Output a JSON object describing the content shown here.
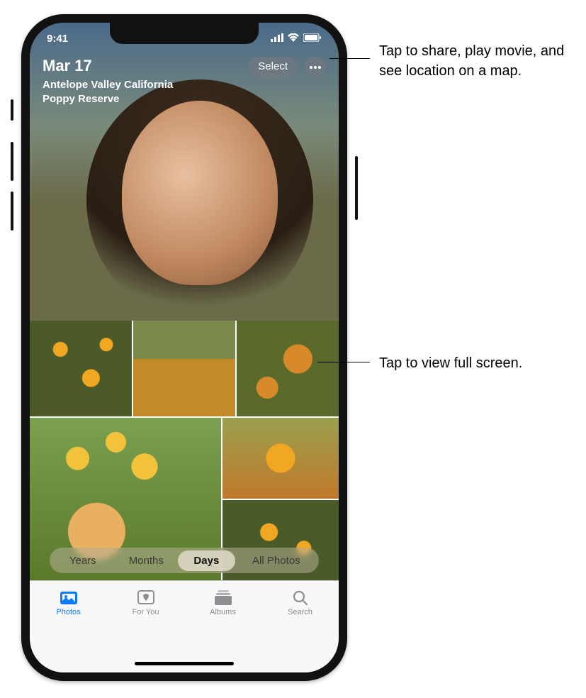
{
  "status": {
    "time": "9:41"
  },
  "hero": {
    "date": "Mar 17",
    "location": "Antelope Valley California Poppy Reserve",
    "select_label": "Select"
  },
  "segments": {
    "years": "Years",
    "months": "Months",
    "days": "Days",
    "all": "All Photos"
  },
  "tabs": {
    "photos": "Photos",
    "for_you": "For You",
    "albums": "Albums",
    "search": "Search"
  },
  "callouts": {
    "more": "Tap to share, play movie, and see location on a map.",
    "thumb": "Tap to view full screen."
  }
}
